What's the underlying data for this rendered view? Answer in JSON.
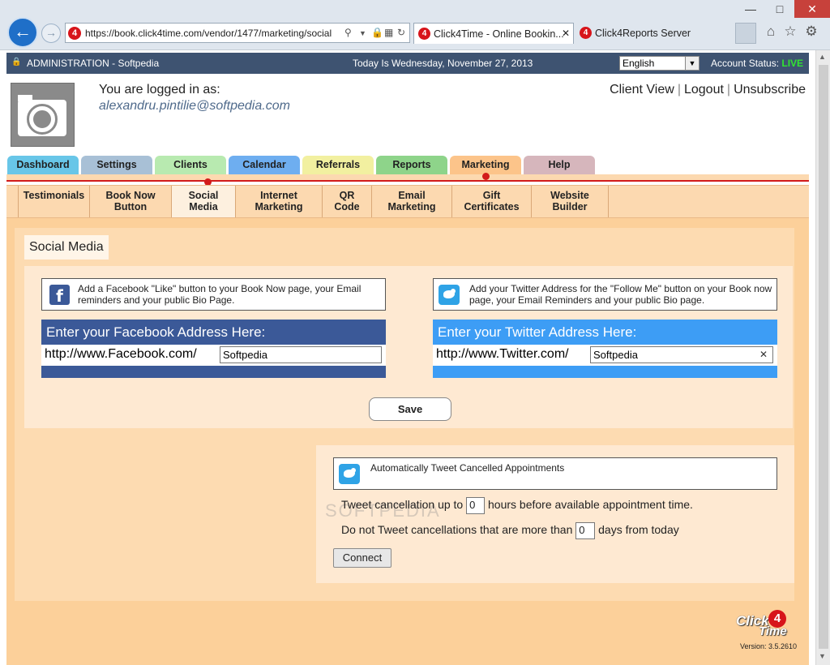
{
  "browser": {
    "url": "https://book.click4time.com/vendor/1477/marketing/social",
    "tabs": [
      {
        "title": "Click4Time - Online Bookin...",
        "active": true
      },
      {
        "title": "Click4Reports Server",
        "active": false
      }
    ],
    "favicon_text": "4"
  },
  "adminbar": {
    "title": "ADMINISTRATION - Softpedia",
    "date": "Today Is Wednesday, November 27, 2013",
    "language": "English",
    "account_status_label": "Account Status:",
    "account_status_value": "LIVE"
  },
  "header": {
    "logged_label": "You are logged in as:",
    "user_email": "alexandru.pintilie@softpedia.com",
    "links": [
      "Client View",
      "Logout",
      "Unsubscribe"
    ]
  },
  "main_tabs": [
    {
      "label": "Dashboard",
      "color": "#68c6e8"
    },
    {
      "label": "Settings",
      "color": "#a8c0d6"
    },
    {
      "label": "Clients",
      "color": "#b8eab0"
    },
    {
      "label": "Calendar",
      "color": "#6eaef0"
    },
    {
      "label": "Referrals",
      "color": "#f2f0a0"
    },
    {
      "label": "Reports",
      "color": "#8ed48a"
    },
    {
      "label": "Marketing",
      "color": "#fcc48a",
      "active": true
    },
    {
      "label": "Help",
      "color": "#d6b6bc"
    }
  ],
  "sub_tabs": [
    {
      "line1": "Testimonials",
      "line2": ""
    },
    {
      "line1": "Book Now",
      "line2": "Button"
    },
    {
      "line1": "Social",
      "line2": "Media",
      "active": true
    },
    {
      "line1": "Internet",
      "line2": "Marketing"
    },
    {
      "line1": "QR",
      "line2": "Code"
    },
    {
      "line1": "Email",
      "line2": "Marketing"
    },
    {
      "line1": "Gift",
      "line2": "Certificates"
    },
    {
      "line1": "Website",
      "line2": "Builder"
    }
  ],
  "page": {
    "title": "Social Media",
    "facebook": {
      "info": "Add a Facebook \"Like\" button to your Book Now page, your Email reminders and your public Bio Page.",
      "header": "Enter your Facebook Address Here:",
      "prefix": "http://www.Facebook.com/",
      "value": "Softpedia",
      "color": "#3b5998"
    },
    "twitter": {
      "info": "Add your Twitter Address for the \"Follow Me\" button on your Book now page, your Email Reminders and your public Bio page.",
      "header": "Enter your Twitter Address Here:",
      "prefix": "http://www.Twitter.com/",
      "value": "Softpedia",
      "color": "#3d9df5"
    },
    "save_label": "Save",
    "tweet": {
      "header": "Automatically Tweet Cancelled Appointments",
      "line1_pre": "Tweet cancellation up to",
      "line1_value": "0",
      "line1_post": "hours before available appointment time.",
      "line2_pre": "Do not Tweet cancellations that are more than",
      "line2_value": "0",
      "line2_post": "days from today",
      "connect_label": "Connect"
    }
  },
  "footer": {
    "logo_top": "Click",
    "logo_num": "4",
    "logo_bottom": "Time",
    "version": "Version: 3.5.2610"
  },
  "watermark": "SOFTPEDIA"
}
